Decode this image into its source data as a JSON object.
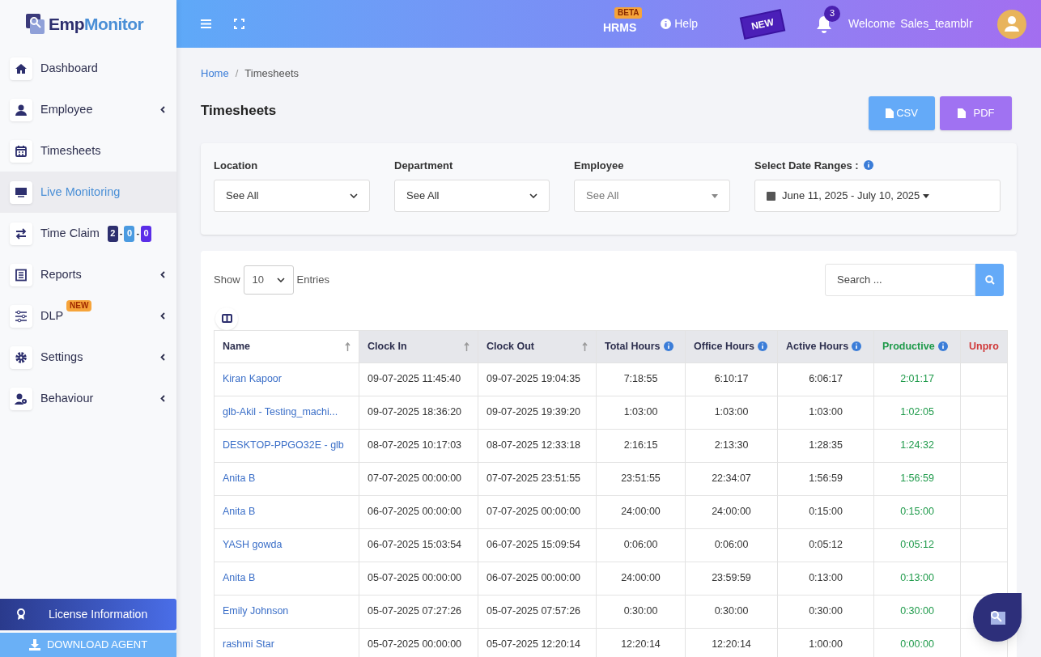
{
  "brand": {
    "part_1": "Emp",
    "part_2": "Monitor"
  },
  "header": {
    "hrms": "HRMS",
    "hrms_badge": "BETA",
    "help": "Help",
    "new_ribbon": "NEW",
    "notifications": "3",
    "welcome": "Welcome",
    "user": "Sales_teamblr"
  },
  "sidebar": {
    "items": [
      {
        "label": "Dashboard",
        "kind": "home",
        "caret": false,
        "selected": false
      },
      {
        "label": "Employee",
        "kind": "user",
        "caret": true,
        "selected": false
      },
      {
        "label": "Timesheets",
        "kind": "calendar",
        "caret": false,
        "selected": false
      },
      {
        "label": "Live Monitoring",
        "kind": "monitor",
        "caret": false,
        "selected": true
      },
      {
        "label": "Time Claim",
        "kind": "swap",
        "caret": false,
        "selected": false,
        "counts": [
          {
            "value": "2",
            "color": "#2d2f6e"
          },
          {
            "value": "0",
            "color": "#4a9ae0"
          },
          {
            "value": "0",
            "color": "#5b2ee8"
          }
        ],
        "separator": "-"
      },
      {
        "label": "Reports",
        "kind": "document",
        "caret": true,
        "selected": false
      },
      {
        "label": "DLP",
        "kind": "sliders",
        "caret": true,
        "selected": false,
        "badge": "NEW"
      },
      {
        "label": "Settings",
        "kind": "gear",
        "caret": true,
        "selected": false
      },
      {
        "label": "Behaviour",
        "kind": "usergear",
        "caret": true,
        "selected": false
      }
    ],
    "license": "License Information",
    "download": "DOWNLOAD AGENT"
  },
  "breadcrumb": [
    "Home",
    "Timesheets"
  ],
  "breadcrumb_separator": "/",
  "page_title": "Timesheets",
  "buttons": [
    "CSV",
    "PDF"
  ],
  "filters": [
    {
      "label": "Location",
      "value": "See All",
      "kind": "select"
    },
    {
      "label": "Department",
      "value": "See All",
      "kind": "select"
    },
    {
      "label": "Employee",
      "placeholder": "See All",
      "kind": "picker"
    },
    {
      "label": "Select Date Ranges :",
      "value": "June 11, 2025 - July 10, 2025",
      "kind": "date"
    }
  ],
  "table_controls": {
    "show": "Show",
    "entries_value": "10",
    "entries": "Entries",
    "search_placeholder": "Search ..."
  },
  "table": {
    "columns": [
      {
        "label": "Name",
        "sortable": true,
        "info": false,
        "kind": "name"
      },
      {
        "label": "Clock In",
        "sortable": true,
        "info": false,
        "kind": "time"
      },
      {
        "label": "Clock Out",
        "sortable": true,
        "info": false,
        "kind": "time"
      },
      {
        "label": "Total Hours",
        "sortable": false,
        "info": true,
        "kind": "duration"
      },
      {
        "label": "Office Hours",
        "sortable": false,
        "info": true,
        "kind": "duration"
      },
      {
        "label": "Active Hours",
        "sortable": false,
        "info": true,
        "kind": "duration"
      },
      {
        "label": "Productive",
        "sortable": false,
        "info": true,
        "kind": "productive"
      },
      {
        "label": "Unpro",
        "sortable": false,
        "info": false,
        "kind": "unproductive"
      }
    ],
    "rows": [
      [
        "Kiran Kapoor",
        "09-07-2025 11:45:40",
        "09-07-2025 19:04:35",
        "7:18:55",
        "6:10:17",
        "6:06:17",
        "2:01:17"
      ],
      [
        "glb-Akil - Testing_machi...",
        "09-07-2025 18:36:20",
        "09-07-2025 19:39:20",
        "1:03:00",
        "1:03:00",
        "1:03:00",
        "1:02:05"
      ],
      [
        "DESKTOP-PPGO32E - glb",
        "08-07-2025 10:17:03",
        "08-07-2025 12:33:18",
        "2:16:15",
        "2:13:30",
        "1:28:35",
        "1:24:32"
      ],
      [
        "Anita B",
        "07-07-2025 00:00:00",
        "07-07-2025 23:51:55",
        "23:51:55",
        "22:34:07",
        "1:56:59",
        "1:56:59"
      ],
      [
        "Anita B",
        "06-07-2025 00:00:00",
        "07-07-2025 00:00:00",
        "24:00:00",
        "24:00:00",
        "0:15:00",
        "0:15:00"
      ],
      [
        "YASH gowda",
        "06-07-2025 15:03:54",
        "06-07-2025 15:09:54",
        "0:06:00",
        "0:06:00",
        "0:05:12",
        "0:05:12"
      ],
      [
        "Anita B",
        "05-07-2025 00:00:00",
        "06-07-2025 00:00:00",
        "24:00:00",
        "23:59:59",
        "0:13:00",
        "0:13:00"
      ],
      [
        "Emily Johnson",
        "05-07-2025 07:27:26",
        "05-07-2025 07:57:26",
        "0:30:00",
        "0:30:00",
        "0:30:00",
        "0:30:00"
      ],
      [
        "rashmi Star",
        "05-07-2025 00:00:00",
        "05-07-2025 12:20:14",
        "12:20:14",
        "12:20:14",
        "1:00:00",
        "0:00:00"
      ]
    ]
  }
}
